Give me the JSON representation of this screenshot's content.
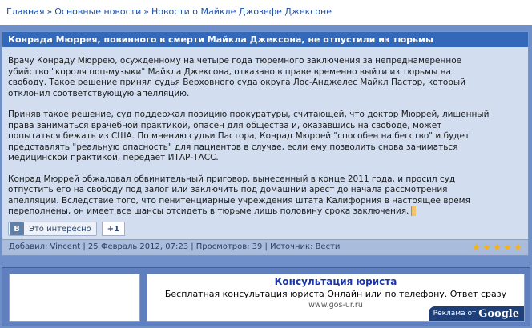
{
  "breadcrumb": {
    "items": [
      "Главная",
      "Основные новости",
      "Новости о Майкле Джозефе Джексоне"
    ],
    "separator": "»"
  },
  "article": {
    "title": "Конрада Мюррея, повинного в смерти Майкла Джексона, не отпустили из тюрьмы",
    "paragraph1": [
      "Врачу Конраду Мюррею, осужденному на четыре года тюремного заключения за непреднамеренное",
      "убийство \"короля поп-музыки\" Майкла Джексона, отказано в праве временно выйти из тюрьмы на",
      "свободу. Такое решение принял судья Верховного суда округа Лос-Анджелес Майкл Пастор, который",
      "отклонил соответствующую апелляцию."
    ],
    "paragraph2": [
      "Приняв такое решение, суд поддержал позицию прокуратуры, считающей, что доктор Мюррей, лишенный",
      "права заниматься врачебной практикой, опасен для общества и, оказавшись на свободе, может",
      "попытаться бежать из США. По мнению судьи Пастора, Конрад Мюррей \"способен на бегство\" и будет",
      "представлять \"реальную опасность\" для пациентов в случае, если ему позволить снова заниматься",
      "медицинской практикой, передает ИТАР-ТАСС."
    ],
    "paragraph3": [
      "Конрад Мюррей обжаловал обвинительный приговор, вынесенный в конце 2011 года, и просил суд",
      "отпустить его на свободу под залог или заключить под домашний арест до начала рассмотрения",
      "апелляции. Вследствие того, что пенитенциарные учреждения штата Калифорния в настоящее время",
      "переполнены, он имеет все шансы отсидеть в тюрьме лишь половину срока заключения."
    ],
    "share": {
      "vk_logo": "B",
      "vk_label": "Это интересно",
      "plus_label": "+1"
    },
    "footer": "Добавил: Vincent | 25 Февраль 2012, 07:23 | Просмотров: 39 | Источник: Вести",
    "rating_stars": 5,
    "star_color": "#f2b318"
  },
  "ad": {
    "title": "Консультация юриста",
    "description": "Бесплатная консультация юриста Онлайн или по телефону. Ответ сразу",
    "url": "www.gos-ur.ru",
    "google_label": "Реклама от",
    "google_logo": "Google"
  },
  "colors": {
    "background": "#6f8fc8",
    "title_bar": "#3468b8",
    "content_bg": "#d2def0",
    "link": "#1e4fa3"
  }
}
